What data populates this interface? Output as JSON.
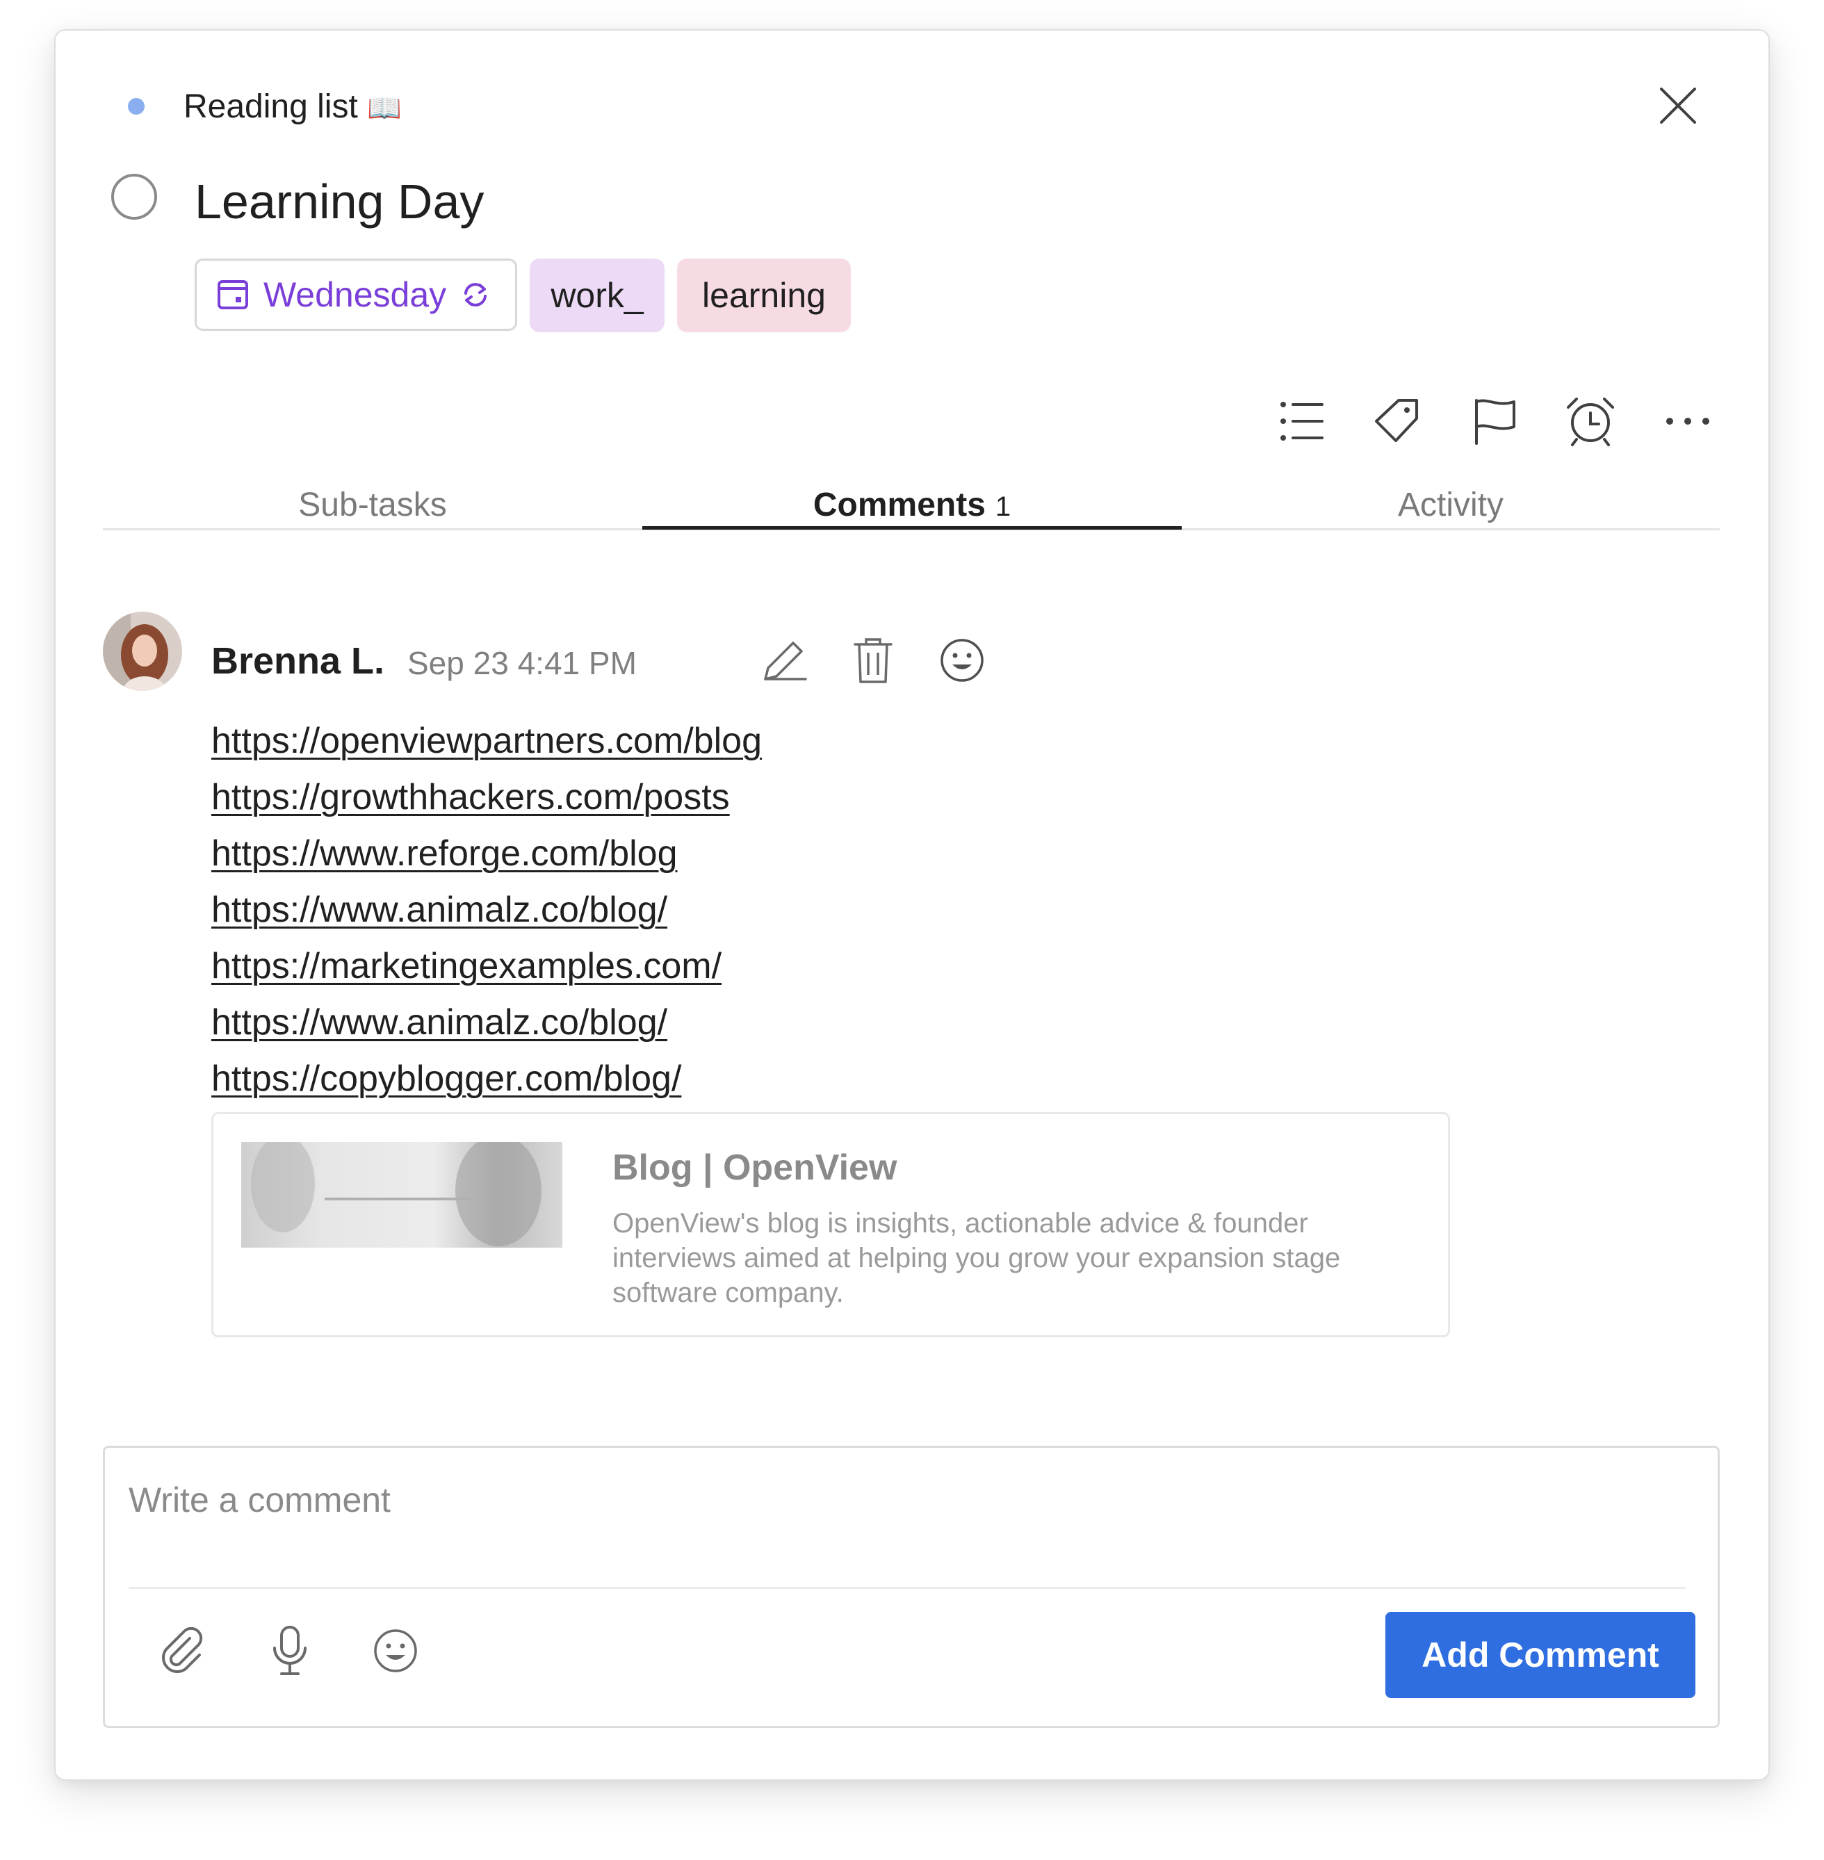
{
  "header": {
    "project_name": "Reading list",
    "project_emoji": "📖",
    "project_color": "#8aaef0",
    "close_icon": "close-icon"
  },
  "task": {
    "title": "Learning Day",
    "due_label": "Wednesday",
    "due_recurring": true,
    "labels": [
      "work_",
      "learning"
    ],
    "accent_color": "#7a3fd8"
  },
  "toolbar": {
    "icons": [
      "subtasks-list-icon",
      "tag-icon",
      "flag-icon",
      "alarm-clock-icon",
      "more-icon"
    ]
  },
  "tabs": [
    {
      "label": "Sub-tasks",
      "count": ""
    },
    {
      "label": "Comments",
      "count": "1",
      "active": true
    },
    {
      "label": "Activity",
      "count": ""
    }
  ],
  "comment": {
    "author": "Brenna L.",
    "time": "Sep 23 4:41 PM",
    "links": [
      "https://openviewpartners.com/blog",
      "https://growthhackers.com/posts",
      "https://www.reforge.com/blog",
      "https://www.animalz.co/blog/",
      "https://marketingexamples.com/",
      "https://www.animalz.co/blog/",
      "https://copyblogger.com/blog/"
    ],
    "preview": {
      "title": "Blog | OpenView",
      "description": "OpenView's blog is insights, actionable advice & founder interviews aimed at helping you grow your expansion stage software company."
    }
  },
  "composer": {
    "placeholder": "Write a comment",
    "value": "",
    "submit_label": "Add Comment",
    "submit_color": "#2f6ee0"
  }
}
